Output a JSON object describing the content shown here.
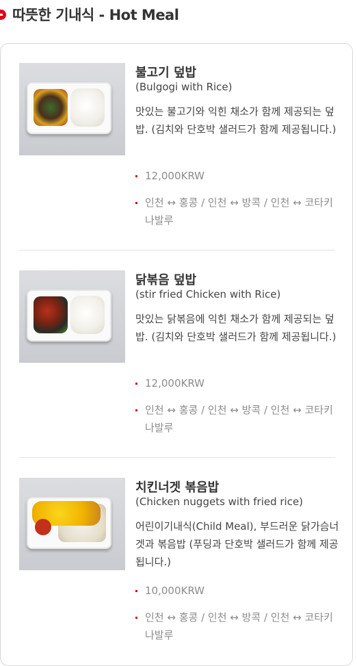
{
  "header": {
    "title": "따뜻한 기내식 - Hot Meal"
  },
  "meals": [
    {
      "name": "불고기 덮밥",
      "english": "(Bulgogi with Rice)",
      "description": "맛있는 불고기와 익힌 채소가 함께 제공되는 덮밥. (김치와 단호박 샐러드가 함께 제공됩니다.)",
      "price": "12,000KRW",
      "routes": "인천 ↔ 홍콩 / 인천 ↔ 방콕 / 인천 ↔ 코타키나발루"
    },
    {
      "name": "닭볶음 덮밥",
      "english": "(stir fried Chicken with Rice)",
      "description": "맛있는 닭볶음에 익힌 채소가 함께 제공되는 덮밥. (김치와 단호박 샐러드가 함께 제공됩니다.)",
      "price": "12,000KRW",
      "routes": "인천 ↔ 홍콩 / 인천 ↔ 방콕 / 인천 ↔ 코타키나발루"
    },
    {
      "name": "치킨너겟 볶음밥",
      "english": "(Chicken nuggets with fried rice)",
      "description": "어린이기내식(Child Meal), 부드러운 닭가슴너겟과 볶음밥 (푸딩과 단호박 샐러드가 함께 제공됩니다.)",
      "price": "10,000KRW",
      "routes": "인천 ↔ 홍콩 / 인천 ↔ 방콕 / 인천 ↔ 코타키나발루"
    }
  ],
  "colors": {
    "accent": "#e1001c",
    "price_text": "#8c8c8c",
    "border": "#d9d9d9"
  }
}
